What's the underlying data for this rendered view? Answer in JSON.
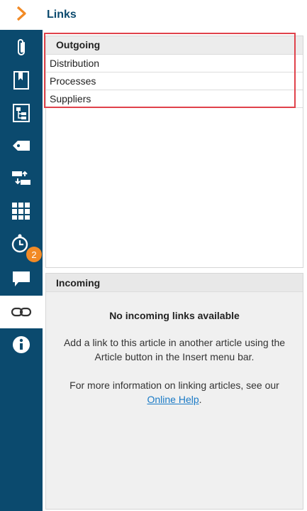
{
  "panel": {
    "title": "Links"
  },
  "rail": {
    "items": [
      {
        "icon": "chevron-right-icon",
        "color": "#f28a25"
      },
      {
        "icon": "paperclip-icon"
      },
      {
        "icon": "bookmark-icon"
      },
      {
        "icon": "structure-icon"
      },
      {
        "icon": "tag-icon"
      },
      {
        "icon": "swap-icon"
      },
      {
        "icon": "grid-icon"
      },
      {
        "icon": "history-icon",
        "badge": "2"
      },
      {
        "icon": "comment-icon"
      },
      {
        "icon": "link-icon",
        "active": true
      },
      {
        "icon": "info-icon"
      }
    ]
  },
  "outgoing": {
    "header": "Outgoing",
    "items": [
      "Distribution",
      "Processes",
      "Suppliers"
    ]
  },
  "incoming": {
    "header": "Incoming",
    "empty_title": "No incoming links available",
    "hint": "Add a link to this article in another article using the Article button in the Insert menu bar.",
    "more_prefix": "For more information on linking articles, see our",
    "help_link": "Online Help",
    "more_suffix": "."
  },
  "colors": {
    "rail": "#0b4a6e",
    "accent": "#f28a25",
    "highlight": "#e0424b",
    "link": "#1a7ac6"
  }
}
